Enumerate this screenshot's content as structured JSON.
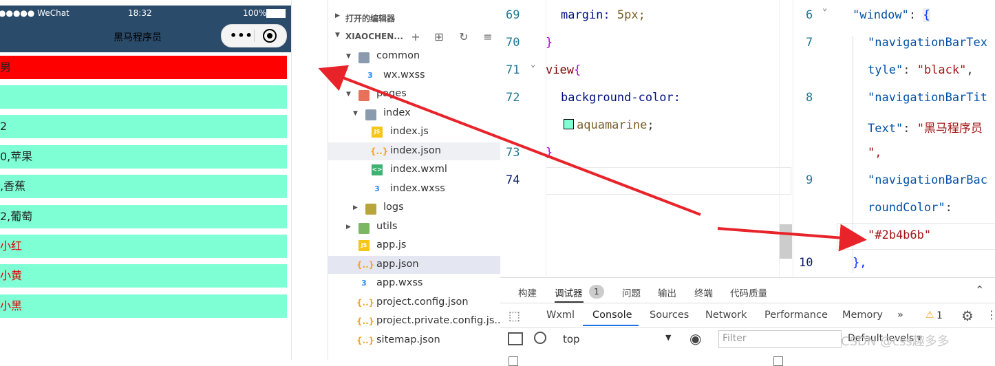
{
  "phone": {
    "status": {
      "carrier": "●●●●● WeChat",
      "time": "18:32",
      "battery": "100%"
    },
    "nav_title": "黑马程序员",
    "capsule_dots": "•••",
    "rows": [
      "男",
      "",
      "2",
      "0,苹果",
      ",香蕉",
      "2,葡萄",
      "小红",
      "小黄",
      "小黑"
    ]
  },
  "explorer": {
    "open_editors": "打开的编辑器",
    "project": "XIAOCHEN...",
    "tree": [
      {
        "label": "common",
        "icon": "folder"
      },
      {
        "label": "wx.wxss",
        "icon": "wxss"
      },
      {
        "label": "pages",
        "icon": "folder-pages"
      },
      {
        "label": "index",
        "icon": "folder"
      },
      {
        "label": "index.js",
        "icon": "js"
      },
      {
        "label": "index.json",
        "icon": "json"
      },
      {
        "label": "index.wxml",
        "icon": "wxml"
      },
      {
        "label": "index.wxss",
        "icon": "wxss"
      },
      {
        "label": "logs",
        "icon": "folder-logs"
      },
      {
        "label": "utils",
        "icon": "folder-utils"
      },
      {
        "label": "app.js",
        "icon": "js"
      },
      {
        "label": "app.json",
        "icon": "json"
      },
      {
        "label": "app.wxss",
        "icon": "wxss"
      },
      {
        "label": "project.config.json",
        "icon": "json"
      },
      {
        "label": "project.private.config.js...",
        "icon": "json"
      },
      {
        "label": "sitemap.json",
        "icon": "json"
      }
    ]
  },
  "editor1": {
    "lines": [
      "69",
      "70",
      "71",
      "72",
      "73",
      "74"
    ],
    "margin_prop": "margin:",
    "margin_val": "5px;",
    "close_brace": "}",
    "view_sel": "view",
    "open_brace": "{",
    "bg_prop": "background-color:",
    "bg_val": "aquamarine",
    "semicolon": ";"
  },
  "editor2": {
    "lines": [
      "6",
      "7",
      "8",
      "9",
      "10"
    ],
    "window_key": "\"window\"",
    "colon": ":",
    "brace": "{",
    "nbts_key_1": "\"navigationBarTex",
    "nbts_key_2": "tyle\"",
    "nbts_val": "\"black\"",
    "nbtt_key_1": "\"navigationBarTit",
    "nbtt_key_2": "Text\"",
    "nbtt_val_1": "\"黑马程序员",
    "nbtt_val_2": "\",",
    "nbbg_key_1": "\"navigationBarBac",
    "nbbg_key_2": "roundColor\"",
    "nbbg_val": "\"#2b4b6b\"",
    "close": "},"
  },
  "panel": {
    "tabs": [
      "构建",
      "调试器",
      "问题",
      "输出",
      "终端",
      "代码质量"
    ],
    "debugger_badge": "1",
    "devtools_tabs": [
      "Wxml",
      "Console",
      "Sources",
      "Network",
      "Performance",
      "Memory"
    ],
    "more": "»",
    "warn_count": "1",
    "context": "top",
    "filter_placeholder": "Filter",
    "levels": "Default levels ▾"
  },
  "watermark": "CSDN @css趣多多",
  "colors": {
    "nav": "#2b4b6b",
    "row": "#7fffd4",
    "red": "#ff0000",
    "arrow": "#e8232a"
  }
}
